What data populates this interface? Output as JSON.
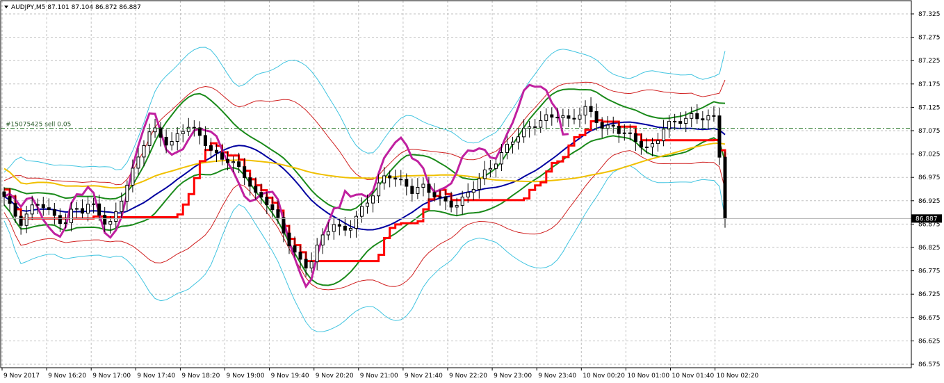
{
  "header": {
    "symbol_line": "AUDJPY,M5  87.101 87.104 86.872 86.887"
  },
  "order_line": {
    "label": "#15075425 sell 0.05",
    "price": 87.08
  },
  "price_marker": {
    "label": "86.887",
    "price": 86.887
  },
  "colors": {
    "background": "#ffffff",
    "grid": "#c0c0c0",
    "candle": "#000000",
    "bb_outer": "#40c4e0",
    "bb_inner": "#d02020",
    "green_band": "#1a8a1a",
    "blue_ma": "#0000a0",
    "slow_ma": "#f0c000",
    "step_line": "#ff0000",
    "purple_line": "#c020a0",
    "order_line": "#2a7a2a"
  },
  "chart_data": {
    "type": "candlestick",
    "title": "AUDJPY,M5",
    "ylim": [
      86.75,
      87.35
    ],
    "y_ticks": [
      "87.325",
      "87.275",
      "87.225",
      "87.175",
      "87.125",
      "87.075",
      "87.025",
      "86.975",
      "86.925",
      "86.875",
      "86.825",
      "86.775",
      "86.725",
      "86.675",
      "86.625",
      "86.575"
    ],
    "y_tick_values": [
      87.325,
      87.275,
      87.225,
      87.175,
      87.125,
      87.075,
      87.025,
      86.975,
      86.925,
      86.875,
      86.825,
      86.775,
      86.725,
      86.675,
      86.625,
      86.575
    ],
    "x_ticks": [
      "9 Nov 2017",
      "9 Nov 16:20",
      "9 Nov 17:00",
      "9 Nov 17:40",
      "9 Nov 18:20",
      "9 Nov 19:00",
      "9 Nov 19:40",
      "9 Nov 20:20",
      "9 Nov 21:00",
      "9 Nov 21:40",
      "9 Nov 22:20",
      "9 Nov 23:00",
      "9 Nov 23:40",
      "10 Nov 00:20",
      "10 Nov 01:00",
      "10 Nov 01:40",
      "10 Nov 02:20"
    ],
    "bars_count": 130,
    "close_path": [
      86.93,
      86.9,
      86.88,
      86.91,
      86.92,
      86.9,
      86.89,
      86.88,
      86.91,
      86.9,
      86.92,
      86.9,
      86.87,
      86.9,
      86.95,
      87.0,
      87.05,
      87.08,
      87.06,
      87.04,
      87.07,
      87.09,
      87.07,
      87.05,
      87.03,
      87.02,
      87.01,
      86.99,
      86.97,
      86.94,
      86.93,
      86.9,
      86.86,
      86.83,
      86.8,
      86.78,
      86.82,
      86.86,
      86.88,
      86.86,
      86.87,
      86.9,
      86.93,
      86.96,
      86.98,
      86.97,
      86.96,
      86.95,
      86.96,
      86.94,
      86.93,
      86.92,
      86.92,
      86.93,
      86.95,
      86.98,
      87.0,
      87.02,
      87.04,
      87.06,
      87.08,
      87.09,
      87.1,
      87.1,
      87.11,
      87.1,
      87.11,
      87.12,
      87.1,
      87.08,
      87.09,
      87.07,
      87.06,
      87.05,
      87.04,
      87.05,
      87.08,
      87.09,
      87.1,
      87.11,
      87.1,
      87.1,
      87.101,
      86.887
    ]
  }
}
